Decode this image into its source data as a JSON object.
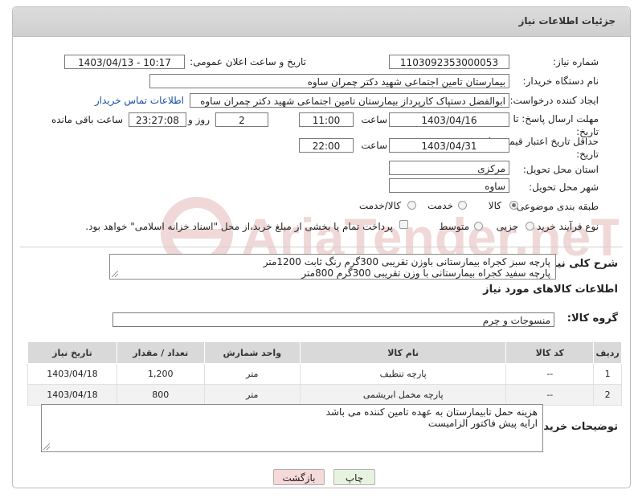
{
  "header": {
    "title": "جزئیات اطلاعات نیاز"
  },
  "form": {
    "need_number_label": "شماره نیاز:",
    "need_number_value": "1103092353000053",
    "announce_datetime_label": "تاریخ و ساعت اعلان عمومی:",
    "announce_datetime_value": "1403/04/13 - 10:17",
    "buyer_org_label": "نام دستگاه خریدار:",
    "buyer_org_value": "بیمارستان تامین اجتماعی شهید دکتر چمران ساوه",
    "requester_label": "ایجاد کننده درخواست:",
    "requester_value": "ابوالفضل  دستپاک  کارپرداز بیمارستان تامین اجتماعی شهید دکتر چمران ساوه",
    "buyer_contact_link": "اطلاعات تماس خریدار",
    "reply_deadline_label": "مهلت ارسال پاسخ: تا تاریخ:",
    "reply_date": "1403/04/16",
    "time_label": "ساعت",
    "reply_time": "11:00",
    "days_value": "2",
    "days_label": "روز و",
    "remaining_time": "23:27:08",
    "remaining_label": "ساعت باقی مانده",
    "price_validity_label": "حداقل تاریخ اعتبار قیمت: تا تاریخ:",
    "validity_date": "1403/04/31",
    "validity_time": "22:00",
    "province_label": "استان محل تحویل:",
    "province_value": "مرکزی",
    "city_label": "شهر محل تحویل:",
    "city_value": "ساوه",
    "category_label": "طبقه بندی موضوعی:",
    "category_options": [
      "کالا",
      "خدمت",
      "کالا/خدمت"
    ],
    "process_label": "نوع فرآیند خرید :",
    "process_options": [
      "جزیی",
      "متوسط"
    ],
    "payment_note": "پرداخت تمام یا بخشی از مبلغ خرید،از محل \"اسناد خزانه اسلامی\" خواهد بود."
  },
  "description": {
    "label": "شرح کلی نیاز:",
    "lines": [
      "پارچه سبز کجراه بیمارستانی باوزن تقریبی 300گرم رنگ ثابت 1200متر",
      "پارچه سفید کجراه بیمارستانی با وزن تقریبی 300گرم 800متر"
    ]
  },
  "goods": {
    "section_title": "اطلاعات کالاهای مورد نیاز",
    "group_label": "گروه کالا:",
    "group_value": "منسوجات و چرم",
    "columns": [
      "ردیف",
      "کد کالا",
      "نام کالا",
      "واحد شمارش",
      "تعداد / مقدار",
      "تاریخ نیاز"
    ],
    "rows": [
      {
        "row": "1",
        "code": "--",
        "name": "پارچه تنظیف",
        "unit": "متر",
        "qty": "1,200",
        "date": "1403/04/18"
      },
      {
        "row": "2",
        "code": "--",
        "name": "پارچه مخمل ابریشمی",
        "unit": "متر",
        "qty": "800",
        "date": "1403/04/18"
      }
    ]
  },
  "buyer_notes": {
    "label": "توضیحات خریدار:",
    "lines": [
      "هزینه حمل تابیمارستان به عهده تامین کننده می باشد",
      "ارایه پیش فاکتور الزامیست"
    ]
  },
  "buttons": {
    "print": "چاپ",
    "back": "بازگشت"
  },
  "watermark": "AriaTender.neT",
  "colors": {
    "titlebar": "#d4d4d4",
    "link": "#1a4fa0",
    "back_button_bg": "#f6d9d9",
    "print_button_bg": "#e8f3df",
    "watermark": "#f0d8d8"
  }
}
